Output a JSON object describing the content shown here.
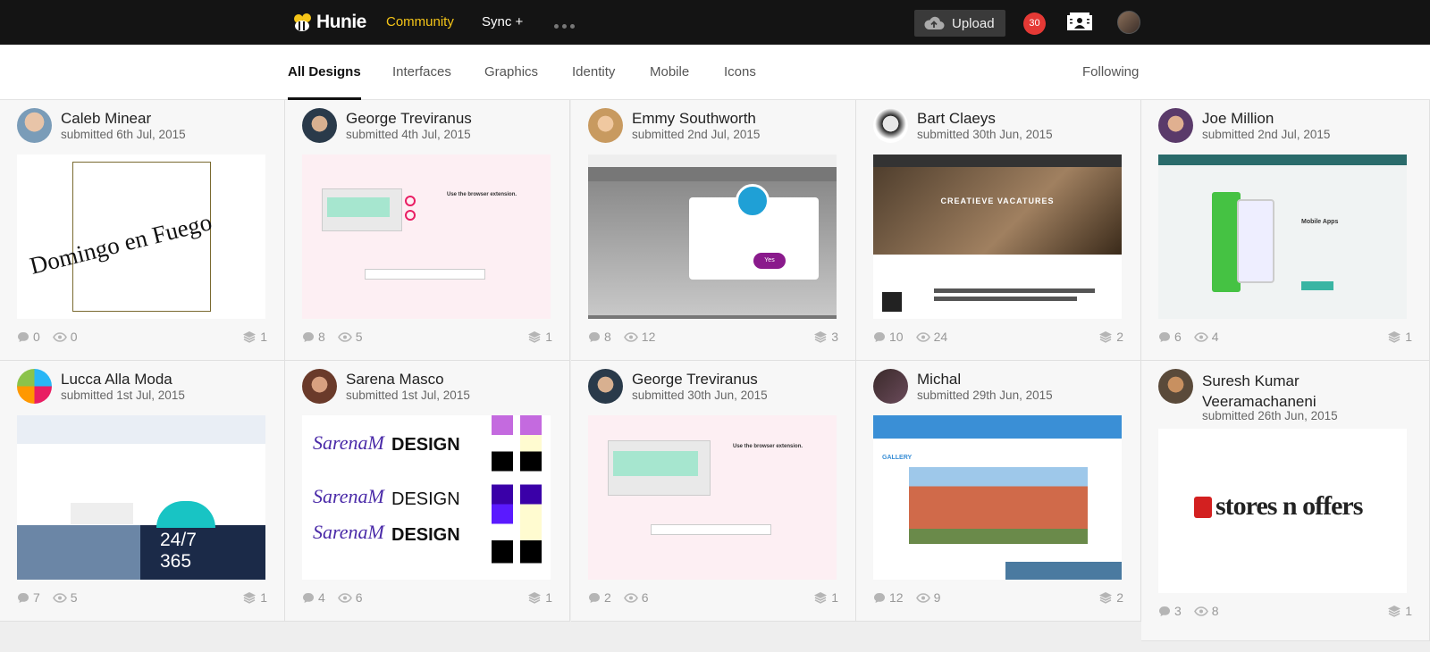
{
  "header": {
    "logo": "Hunie",
    "nav": {
      "community": "Community",
      "sync": "Sync +"
    },
    "upload_label": "Upload",
    "notifications_count": "30"
  },
  "subnav": {
    "tabs": [
      "All Designs",
      "Interfaces",
      "Graphics",
      "Identity",
      "Mobile",
      "Icons"
    ],
    "active": "All Designs",
    "following": "Following"
  },
  "cards": [
    {
      "author": "Caleb Minear",
      "date": "submitted 6th Jul, 2015",
      "comments": "0",
      "views": "0",
      "layers": "1",
      "thumb_text": "Domingo en Fuego"
    },
    {
      "author": "George Treviranus",
      "date": "submitted 4th Jul, 2015",
      "comments": "8",
      "views": "5",
      "layers": "1",
      "thumb_text": "Use the browser extension."
    },
    {
      "author": "Emmy Southworth",
      "date": "submitted 2nd Jul, 2015",
      "comments": "8",
      "views": "12",
      "layers": "3",
      "thumb_text": "Yes"
    },
    {
      "author": "Bart Claeys",
      "date": "submitted 30th Jun, 2015",
      "comments": "10",
      "views": "24",
      "layers": "2",
      "thumb_text": "CREATIEVE VACATURES"
    },
    {
      "author": "Joe Million",
      "date": "submitted 2nd Jul, 2015",
      "comments": "6",
      "views": "4",
      "layers": "1",
      "thumb_text": "Mobile Apps"
    },
    {
      "author": "Lucca Alla Moda",
      "date": "submitted 1st Jul, 2015",
      "comments": "7",
      "views": "5",
      "layers": "1",
      "thumb_text": "24/7 365"
    },
    {
      "author": "Sarena Masco",
      "date": "submitted 1st Jul, 2015",
      "comments": "4",
      "views": "6",
      "layers": "1",
      "thumb_text": "DESIGN"
    },
    {
      "author": "George Treviranus",
      "date": "submitted 30th Jun, 2015",
      "comments": "2",
      "views": "6",
      "layers": "1",
      "thumb_text": "Use the browser extension."
    },
    {
      "author": "Michal",
      "date": "submitted 29th Jun, 2015",
      "comments": "12",
      "views": "9",
      "layers": "2",
      "thumb_text": "GALLERY"
    },
    {
      "author": "Suresh Kumar Veeramachaneni",
      "date": "submitted 26th Jun, 2015",
      "comments": "3",
      "views": "8",
      "layers": "1",
      "thumb_text": "stores n offers"
    }
  ],
  "colors": {
    "accent": "#f5c518",
    "topbar": "#141414",
    "badge": "#e53935"
  }
}
